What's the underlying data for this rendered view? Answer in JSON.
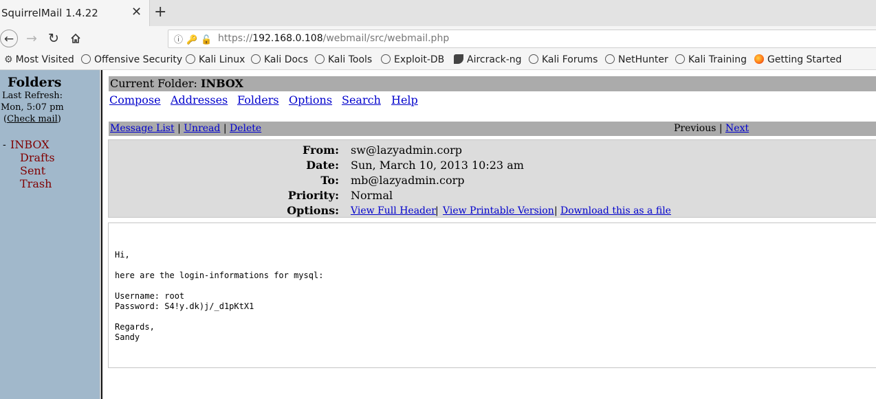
{
  "browser": {
    "tab_title": "SquirrelMail 1.4.22",
    "tab_close": "✕",
    "new_tab": "+",
    "url_prefix": "https://",
    "url_host": "192.168.0.108",
    "url_path": "/webmail/src/webmail.php",
    "bookmarks": [
      {
        "label": "Most Visited",
        "icon": "gear-icon"
      },
      {
        "label": "Offensive Security",
        "icon": "globe-icon"
      },
      {
        "label": "Kali Linux",
        "icon": "globe-icon"
      },
      {
        "label": "Kali Docs",
        "icon": "globe-icon"
      },
      {
        "label": "Kali Tools",
        "icon": "globe-icon"
      },
      {
        "label": "Exploit-DB",
        "icon": "globe-icon"
      },
      {
        "label": "Aircrack-ng",
        "icon": "aircrack-icon"
      },
      {
        "label": "Kali Forums",
        "icon": "globe-icon"
      },
      {
        "label": "NetHunter",
        "icon": "globe-icon"
      },
      {
        "label": "Kali Training",
        "icon": "globe-icon"
      },
      {
        "label": "Getting Started",
        "icon": "firefox-icon"
      }
    ]
  },
  "sidebar": {
    "title": "Folders",
    "refresh_label": "Last Refresh:",
    "refresh_time": "Mon, 5:07 pm",
    "check_mail_open": "(",
    "check_mail": "Check mail",
    "check_mail_close": ")",
    "folders": [
      "INBOX",
      "Drafts",
      "Sent",
      "Trash"
    ],
    "active_folder_marker": "-"
  },
  "main": {
    "current_folder_label": "Current Folder: ",
    "current_folder": "INBOX",
    "menu": [
      "Compose",
      "Addresses",
      "Folders",
      "Options",
      "Search",
      "Help"
    ],
    "msgbar": {
      "message_list": "Message List",
      "unread": "Unread",
      "delete": "Delete",
      "previous": "Previous",
      "next": "Next",
      "separator": "|"
    },
    "headers": {
      "from_label": "From:",
      "from": "sw@lazyadmin.corp",
      "date_label": "Date:",
      "date": "Sun, March 10, 2013 10:23 am",
      "to_label": "To:",
      "to": "mb@lazyadmin.corp",
      "priority_label": "Priority:",
      "priority": "Normal",
      "options_label": "Options:",
      "options": [
        "View Full Header",
        "View Printable Version",
        "Download this as a file"
      ]
    },
    "body": "Hi,\n\nhere are the login-informations for mysql:\n\nUsername: root\nPassword: S4!y.dk)j/_d1pKtX1\n\nRegards,\nSandy"
  },
  "colors": {
    "sidebar_bg": "#a1b8cb",
    "folder_link": "#800000",
    "bar_gray": "#ababab",
    "header_bg": "#dcdcdc",
    "link": "#0000cc"
  }
}
